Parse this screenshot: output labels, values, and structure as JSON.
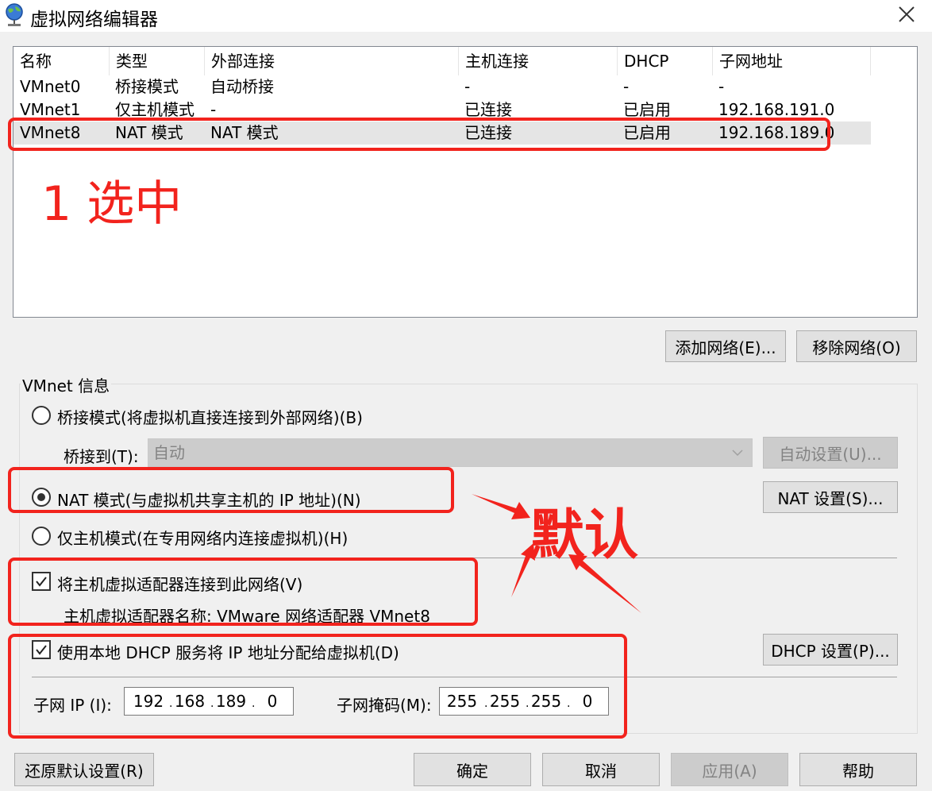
{
  "window": {
    "title": "虚拟网络编辑器"
  },
  "columns": [
    "名称",
    "类型",
    "外部连接",
    "主机连接",
    "DHCP",
    "子网地址"
  ],
  "networks": [
    {
      "name": "VMnet0",
      "type": "桥接模式",
      "external": "自动桥接",
      "host": "-",
      "dhcp": "-",
      "subnet": "-"
    },
    {
      "name": "VMnet1",
      "type": "仅主机模式",
      "external": "-",
      "host": "已连接",
      "dhcp": "已启用",
      "subnet": "192.168.191.0"
    },
    {
      "name": "VMnet8",
      "type": "NAT 模式",
      "external": "NAT 模式",
      "host": "已连接",
      "dhcp": "已启用",
      "subnet": "192.168.189.0"
    }
  ],
  "list_buttons": {
    "add": "添加网络(E)...",
    "remove": "移除网络(O)"
  },
  "vmnet_info": {
    "title": "VMnet 信息",
    "bridged_label": "桥接模式(将虚拟机直接连接到外部网络)(B)",
    "bridge_to_label": "桥接到(T):",
    "bridge_to_value": "自动",
    "auto_settings": "自动设置(U)...",
    "nat_label": "NAT 模式(与虚拟机共享主机的 IP 地址)(N)",
    "nat_settings": "NAT 设置(S)...",
    "hostonly_label": "仅主机模式(在专用网络内连接虚拟机)(H)",
    "connect_adapter_label": "将主机虚拟适配器连接到此网络(V)",
    "adapter_name_label": "主机虚拟适配器名称: VMware 网络适配器 VMnet8",
    "dhcp_label": "使用本地 DHCP 服务将 IP 地址分配给虚拟机(D)",
    "dhcp_settings": "DHCP 设置(P)...",
    "subnet_ip_label": "子网 IP (I):",
    "subnet_ip": [
      "192",
      "168",
      "189",
      "0"
    ],
    "subnet_mask_label": "子网掩码(M):",
    "subnet_mask": [
      "255",
      "255",
      "255",
      "0"
    ]
  },
  "footer_buttons": {
    "restore": "还原默认设置(R)",
    "ok": "确定",
    "cancel": "取消",
    "apply": "应用(A)",
    "help": "帮助"
  },
  "annotations": {
    "step1": "1 选中",
    "default": "默认"
  },
  "colors": {
    "annotation_red": "#f2231d",
    "window_bg": "#f0f0f0",
    "selected_row": "#e5e5e5"
  }
}
